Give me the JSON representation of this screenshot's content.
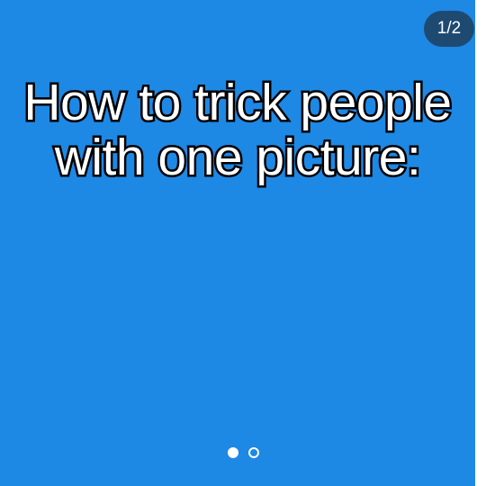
{
  "slide": {
    "background_color": "#1e88e5",
    "caption_lines": [
      "How to trick people",
      "with one picture:"
    ]
  },
  "counter": {
    "text": "1/2"
  },
  "pagination": {
    "current_page": 1,
    "total_pages": 2
  }
}
